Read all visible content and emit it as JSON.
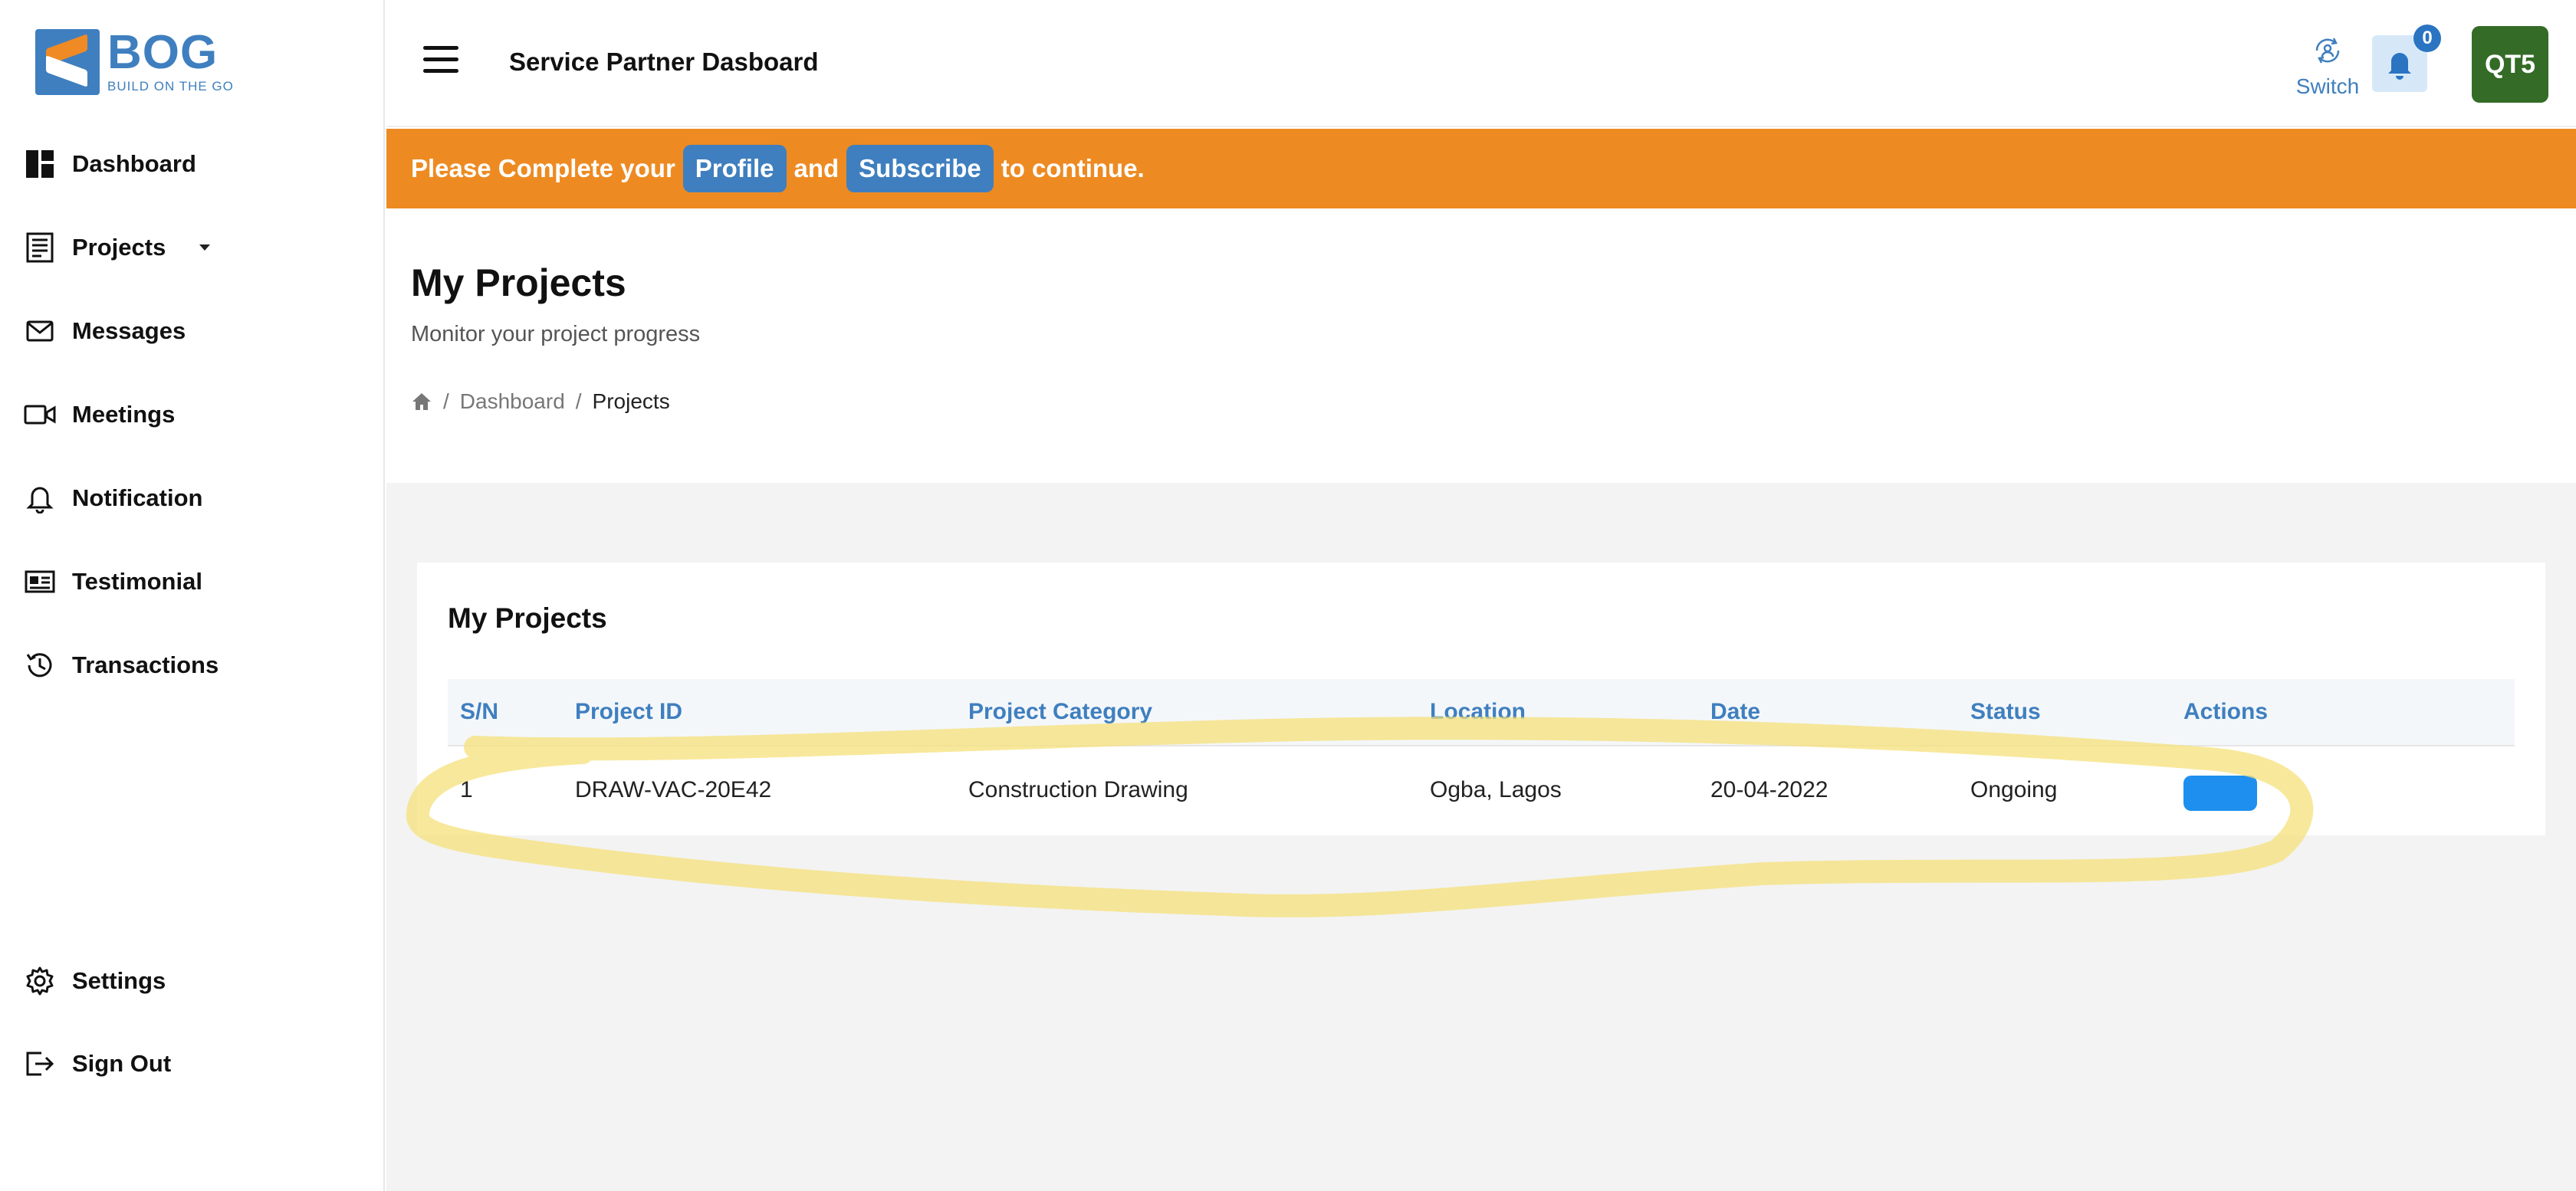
{
  "brand": {
    "title": "BOG",
    "tagline": "BUILD ON THE GO",
    "colors": {
      "primary": "#3f7fbf",
      "accent": "#f08a24",
      "avatar": "#346b27",
      "action": "#1e8fee",
      "highlight": "#f5e07a"
    }
  },
  "sidebar": {
    "items": [
      {
        "label": "Dashboard",
        "icon": "dashboard-icon"
      },
      {
        "label": "Projects",
        "icon": "projects-icon"
      },
      {
        "label": "Messages",
        "icon": "mail-icon"
      },
      {
        "label": "Meetings",
        "icon": "video-icon"
      },
      {
        "label": "Notification",
        "icon": "bell-icon"
      },
      {
        "label": "Testimonial",
        "icon": "testimonial-icon"
      },
      {
        "label": "Transactions",
        "icon": "history-icon"
      }
    ],
    "bottom": [
      {
        "label": "Settings",
        "icon": "gear-icon"
      },
      {
        "label": "Sign Out",
        "icon": "sign-out-icon"
      }
    ]
  },
  "header": {
    "title": "Service Partner Dasboard",
    "switch_label": "Switch",
    "notification_count": "0",
    "avatar_initials": "QT5"
  },
  "banner": {
    "prefix": "Please Complete your",
    "profile_label": "Profile",
    "conjunction": "and",
    "subscribe_label": "Subscribe",
    "suffix": "to continue."
  },
  "page": {
    "title": "My Projects",
    "subtitle": "Monitor your project progress",
    "breadcrumb": {
      "separator": "/",
      "dashboard": "Dashboard",
      "current": "Projects"
    }
  },
  "projects_card": {
    "title": "My Projects",
    "columns": [
      "S/N",
      "Project ID",
      "Project Category",
      "Location",
      "Date",
      "Status",
      "Actions"
    ],
    "rows": [
      {
        "sn": "1",
        "project_id": "DRAW-VAC-20E42",
        "category": "Construction Drawing",
        "location": "Ogba, Lagos",
        "date": "20-04-2022",
        "status": "Ongoing"
      }
    ]
  }
}
